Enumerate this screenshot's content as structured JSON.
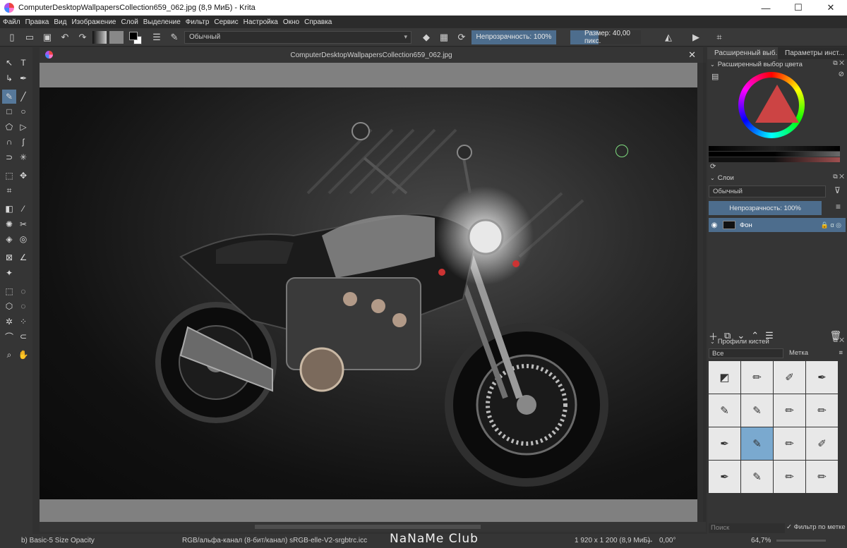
{
  "window": {
    "title": "ComputerDesktopWallpapersCollection659_062.jpg (8,9 МиБ)  - Krita",
    "minimize": "—",
    "maximize": "☐",
    "close": "✕"
  },
  "menu": [
    "Файл",
    "Правка",
    "Вид",
    "Изображение",
    "Слой",
    "Выделение",
    "Фильтр",
    "Сервис",
    "Настройка",
    "Окно",
    "Справка"
  ],
  "toolbar": {
    "blend_mode": "Обычный",
    "opacity": "Непрозрачность: 100%",
    "size": "Размер: 40,00 пикс."
  },
  "document": {
    "tab_title": "ComputerDesktopWallpapersCollection659_062.jpg",
    "close": "✕"
  },
  "dock": {
    "tabs": [
      "Расширенный выб...",
      "Параметры инст..."
    ],
    "color_panel_title": "Расширенный выбор цвета",
    "layers_title": "Слои",
    "layers_blend": "Обычный",
    "layers_opacity": "Непрозрачность:  100%",
    "layer_name": "Фон",
    "brush_title": "Профили кистей",
    "brush_filter": "Все",
    "brush_tag": "Метка",
    "brush_search_placeholder": "Поиск",
    "brush_search_filter": "Фильтр по метке"
  },
  "status": {
    "brush": "b) Basic-5 Size Opacity",
    "color_info": "RGB/альфа-канал (8-бит/канал)  sRGB-elle-V2-srgbtrc.icc",
    "dimensions": "1 920 x 1 200 (8,9 МиБ)",
    "rotation": "0,00°",
    "zoom": "64,7%"
  },
  "watermark": "NaNaMe Club",
  "colors": {
    "accent": "#4d6d8d",
    "cursor": "#7fdc7f"
  }
}
